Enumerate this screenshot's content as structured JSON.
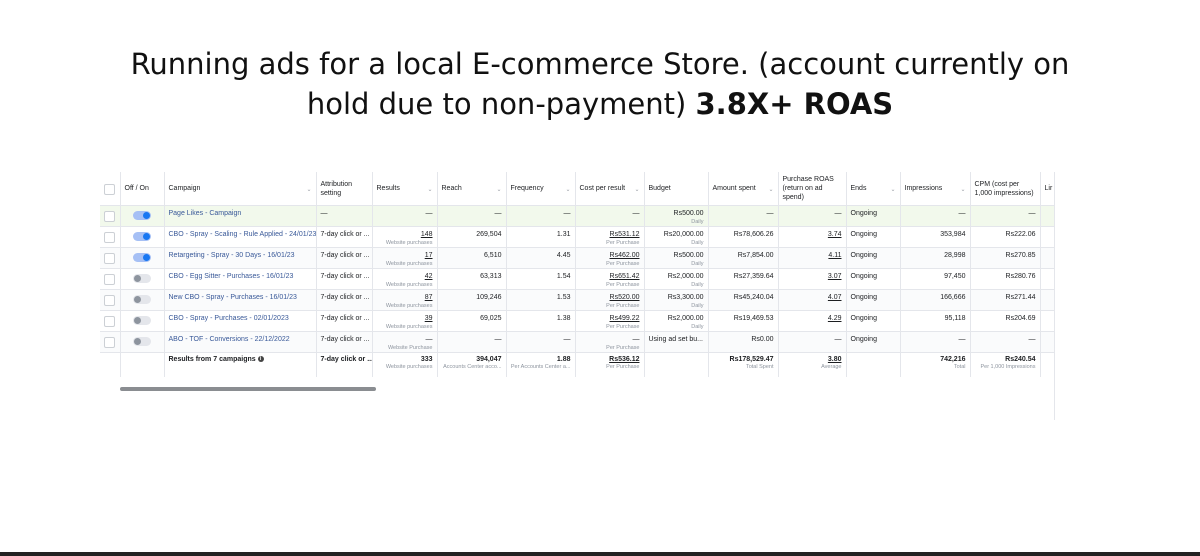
{
  "heading": {
    "line1": "Running ads for a local E-commerce Store. (account currently on",
    "line2": "hold due to non-payment)",
    "line2_bold": "3.8X+ ROAS"
  },
  "table": {
    "headers": {
      "off_on": "Off / On",
      "campaign": "Campaign",
      "attribution": "Attribution setting",
      "results": "Results",
      "reach": "Reach",
      "frequency": "Frequency",
      "cost": "Cost per result",
      "budget": "Budget",
      "amount": "Amount spent",
      "roas": "Purchase ROAS (return on ad spend)",
      "ends": "Ends",
      "impressions": "Impressions",
      "cpm": "CPM (cost per 1,000 impressions)",
      "last": "Lir"
    },
    "rows": [
      {
        "on": true,
        "highlight": true,
        "campaign": "Page Likes - Campaign",
        "attribution": "—",
        "results": "—",
        "results_sub": "",
        "reach": "—",
        "frequency": "—",
        "cost": "—",
        "cost_sub": "",
        "budget": "Rs500.00",
        "budget_sub": "Daily",
        "amount": "—",
        "roas": "—",
        "ends": "Ongoing",
        "impressions": "—",
        "cpm": "—"
      },
      {
        "on": true,
        "highlight": false,
        "campaign": "CBO - Spray - Scaling - Rule Applied - 24/01/23",
        "attribution": "7-day click or ...",
        "results": "148",
        "results_sub": "Website purchases",
        "reach": "269,504",
        "frequency": "1.31",
        "cost": "Rs531.12",
        "cost_sub": "Per Purchase",
        "budget": "Rs20,000.00",
        "budget_sub": "Daily",
        "amount": "Rs78,606.26",
        "roas": "3.74",
        "ends": "Ongoing",
        "impressions": "353,984",
        "cpm": "Rs222.06"
      },
      {
        "on": true,
        "highlight": false,
        "campaign": "Retargeting - Spray - 30 Days - 16/01/23",
        "attribution": "7-day click or ...",
        "results": "17",
        "results_sub": "Website purchases",
        "reach": "6,510",
        "frequency": "4.45",
        "cost": "Rs462.00",
        "cost_sub": "Per Purchase",
        "budget": "Rs500.00",
        "budget_sub": "Daily",
        "amount": "Rs7,854.00",
        "roas": "4.11",
        "ends": "Ongoing",
        "impressions": "28,998",
        "cpm": "Rs270.85"
      },
      {
        "on": false,
        "highlight": false,
        "campaign": "CBO - Egg Sitter - Purchases - 16/01/23",
        "attribution": "7-day click or ...",
        "results": "42",
        "results_sub": "Website purchases",
        "reach": "63,313",
        "frequency": "1.54",
        "cost": "Rs651.42",
        "cost_sub": "Per Purchase",
        "budget": "Rs2,000.00",
        "budget_sub": "Daily",
        "amount": "Rs27,359.64",
        "roas": "3.07",
        "ends": "Ongoing",
        "impressions": "97,450",
        "cpm": "Rs280.76"
      },
      {
        "on": false,
        "highlight": false,
        "campaign": "New CBO - Spray - Purchases - 16/01/23",
        "attribution": "7-day click or ...",
        "results": "87",
        "results_sub": "Website purchases",
        "reach": "109,246",
        "frequency": "1.53",
        "cost": "Rs520.00",
        "cost_sub": "Per Purchase",
        "budget": "Rs3,300.00",
        "budget_sub": "Daily",
        "amount": "Rs45,240.04",
        "roas": "4.07",
        "ends": "Ongoing",
        "impressions": "166,666",
        "cpm": "Rs271.44"
      },
      {
        "on": false,
        "highlight": false,
        "campaign": "CBO - Spray - Purchases - 02/01/2023",
        "attribution": "7-day click or ...",
        "results": "39",
        "results_sub": "Website purchases",
        "reach": "69,025",
        "frequency": "1.38",
        "cost": "Rs499.22",
        "cost_sub": "Per Purchase",
        "budget": "Rs2,000.00",
        "budget_sub": "Daily",
        "amount": "Rs19,469.53",
        "roas": "4.29",
        "ends": "Ongoing",
        "impressions": "95,118",
        "cpm": "Rs204.69"
      },
      {
        "on": false,
        "highlight": false,
        "campaign": "ABO - TOF - Conversions - 22/12/2022",
        "attribution": "7-day click or ...",
        "results": "—",
        "results_sub": "Website Purchase",
        "reach": "—",
        "frequency": "—",
        "cost": "—",
        "cost_sub": "Per Purchase",
        "budget": "Using ad set bu...",
        "budget_sub": "",
        "amount": "Rs0.00",
        "roas": "—",
        "ends": "Ongoing",
        "impressions": "—",
        "cpm": "—"
      }
    ],
    "totals": {
      "label": "Results from 7 campaigns",
      "attribution": "7-day click or ...",
      "results": "333",
      "results_sub": "Website purchases",
      "reach": "394,047",
      "reach_sub": "Accounts Center acco...",
      "frequency": "1.88",
      "frequency_sub": "Per Accounts Center a...",
      "cost": "Rs536.12",
      "cost_sub": "Per Purchase",
      "amount": "Rs178,529.47",
      "amount_sub": "Total Spent",
      "roas": "3.80",
      "roas_sub": "Average",
      "impressions": "742,216",
      "impressions_sub": "Total",
      "cpm": "Rs240.54",
      "cpm_sub": "Per 1,000 Impressions"
    }
  }
}
